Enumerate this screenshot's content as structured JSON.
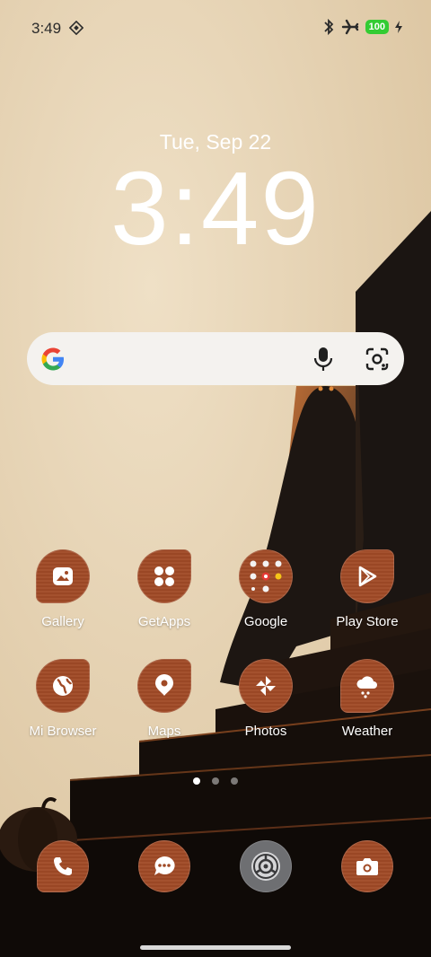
{
  "status_bar": {
    "time": "3:49",
    "battery": "100",
    "icons": [
      "bluetooth-icon",
      "airplane-icon",
      "charging-icon"
    ]
  },
  "lockscreen": {
    "date": "Tue, Sep 22",
    "clock": "3:49"
  },
  "search_bar": {
    "icons": [
      "google-logo-icon",
      "microphone-icon",
      "google-lens-icon"
    ]
  },
  "apps": [
    {
      "label": "Gallery",
      "icon": "gallery-icon"
    },
    {
      "label": "GetApps",
      "icon": "getapps-icon"
    },
    {
      "label": "Google",
      "icon": "folder-icon"
    },
    {
      "label": "Play Store",
      "icon": "play-store-icon"
    },
    {
      "label": "Mi Browser",
      "icon": "globe-icon"
    },
    {
      "label": "Maps",
      "icon": "map-pin-icon"
    },
    {
      "label": "Photos",
      "icon": "pinwheel-icon"
    },
    {
      "label": "Weather",
      "icon": "weather-cloud-icon"
    }
  ],
  "page_indicator": {
    "pages": 3,
    "current": 1
  },
  "dock": [
    {
      "icon": "phone-icon"
    },
    {
      "icon": "messages-icon"
    },
    {
      "icon": "settings-gear-icon"
    },
    {
      "icon": "camera-icon"
    }
  ],
  "colors": {
    "icon_background": "#a04a26",
    "wallpaper_sky": "#e6d3b4",
    "battery_green": "#33cc33"
  }
}
